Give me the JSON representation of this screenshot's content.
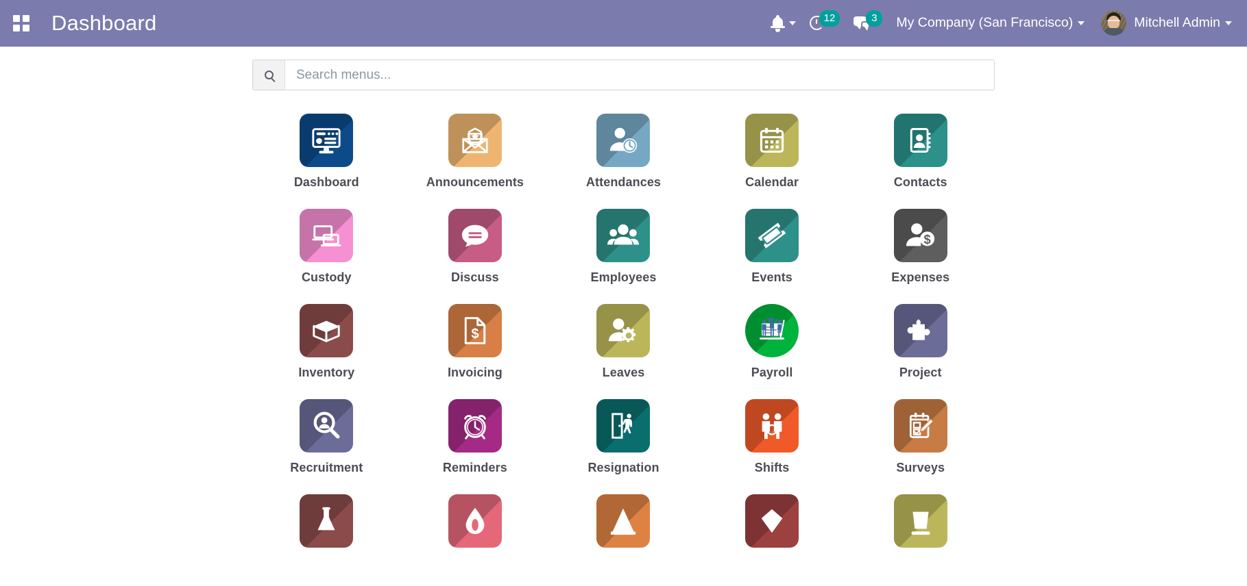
{
  "header": {
    "apps_menu_icon": "grid-apps-icon",
    "title": "Dashboard",
    "activities": {
      "bell_icon": "bell-icon",
      "clock_icon": "clock-activity-icon",
      "clock_count": "12",
      "messages_icon": "messages-icon",
      "messages_count": "3"
    },
    "company": "My Company (San Francisco)",
    "user": "Mitchell Admin"
  },
  "search": {
    "icon": "search-icon",
    "value": "",
    "placeholder": "Search menus..."
  },
  "colors": {
    "header_bg": "#7C7BAD",
    "badge_bg": "#00A09D",
    "label_text": "#4C4C54"
  },
  "apps": [
    {
      "label": "Dashboard",
      "icon": "monitor-dashboard-icon",
      "color": "#0C4A8A",
      "shape": "rounded"
    },
    {
      "label": "Announcements",
      "icon": "envelope-star-icon",
      "color": "#EFB570",
      "shape": "rounded"
    },
    {
      "label": "Attendances",
      "icon": "person-clock-icon",
      "color": "#76A8C4",
      "shape": "rounded"
    },
    {
      "label": "Calendar",
      "icon": "calendar-icon",
      "color": "#BBB65A",
      "shape": "rounded"
    },
    {
      "label": "Contacts",
      "icon": "address-book-icon",
      "color": "#2B9189",
      "shape": "rounded"
    },
    {
      "label": "Custody",
      "icon": "devices-icon",
      "color": "#F690D2",
      "shape": "rounded"
    },
    {
      "label": "Discuss",
      "icon": "speech-bubble-icon",
      "color": "#C75C84",
      "shape": "rounded"
    },
    {
      "label": "Employees",
      "icon": "people-group-icon",
      "color": "#2E9189",
      "shape": "rounded"
    },
    {
      "label": "Events",
      "icon": "ticket-icon",
      "color": "#2E9189",
      "shape": "rounded"
    },
    {
      "label": "Expenses",
      "icon": "person-dollar-icon",
      "color": "#5E5E5E",
      "shape": "rounded"
    },
    {
      "label": "Inventory",
      "icon": "open-box-icon",
      "color": "#8B4B4B",
      "shape": "rounded"
    },
    {
      "label": "Invoicing",
      "icon": "invoice-dollar-icon",
      "color": "#D77F46",
      "shape": "rounded"
    },
    {
      "label": "Leaves",
      "icon": "person-gear-icon",
      "color": "#BBB65A",
      "shape": "rounded"
    },
    {
      "label": "Payroll",
      "icon": "paycheck-people-icon",
      "color": "#00B33C",
      "shape": "circle"
    },
    {
      "label": "Project",
      "icon": "puzzle-piece-icon",
      "color": "#6C6C99",
      "shape": "rounded"
    },
    {
      "label": "Recruitment",
      "icon": "magnifier-person-icon",
      "color": "#6C6C99",
      "shape": "rounded"
    },
    {
      "label": "Reminders",
      "icon": "alarm-clock-icon",
      "color": "#A52A86",
      "shape": "rounded"
    },
    {
      "label": "Resignation",
      "icon": "door-exit-icon",
      "color": "#0A6E6E",
      "shape": "rounded"
    },
    {
      "label": "Shifts",
      "icon": "two-people-icon",
      "color": "#F05A28",
      "shape": "rounded"
    },
    {
      "label": "Surveys",
      "icon": "clipboard-pencil-icon",
      "color": "#C77B45",
      "shape": "rounded"
    },
    {
      "label": "",
      "icon": "flask-icon",
      "color": "#8B4B4B",
      "shape": "rounded"
    },
    {
      "label": "",
      "icon": "droplet-icon",
      "color": "#E4687A",
      "shape": "rounded"
    },
    {
      "label": "",
      "icon": "cone-icon",
      "color": "#DE8244",
      "shape": "rounded"
    },
    {
      "label": "",
      "icon": "diamond-icon",
      "color": "#9C4040",
      "shape": "rounded"
    },
    {
      "label": "",
      "icon": "cup-icon",
      "color": "#BBB65A",
      "shape": "rounded"
    }
  ]
}
